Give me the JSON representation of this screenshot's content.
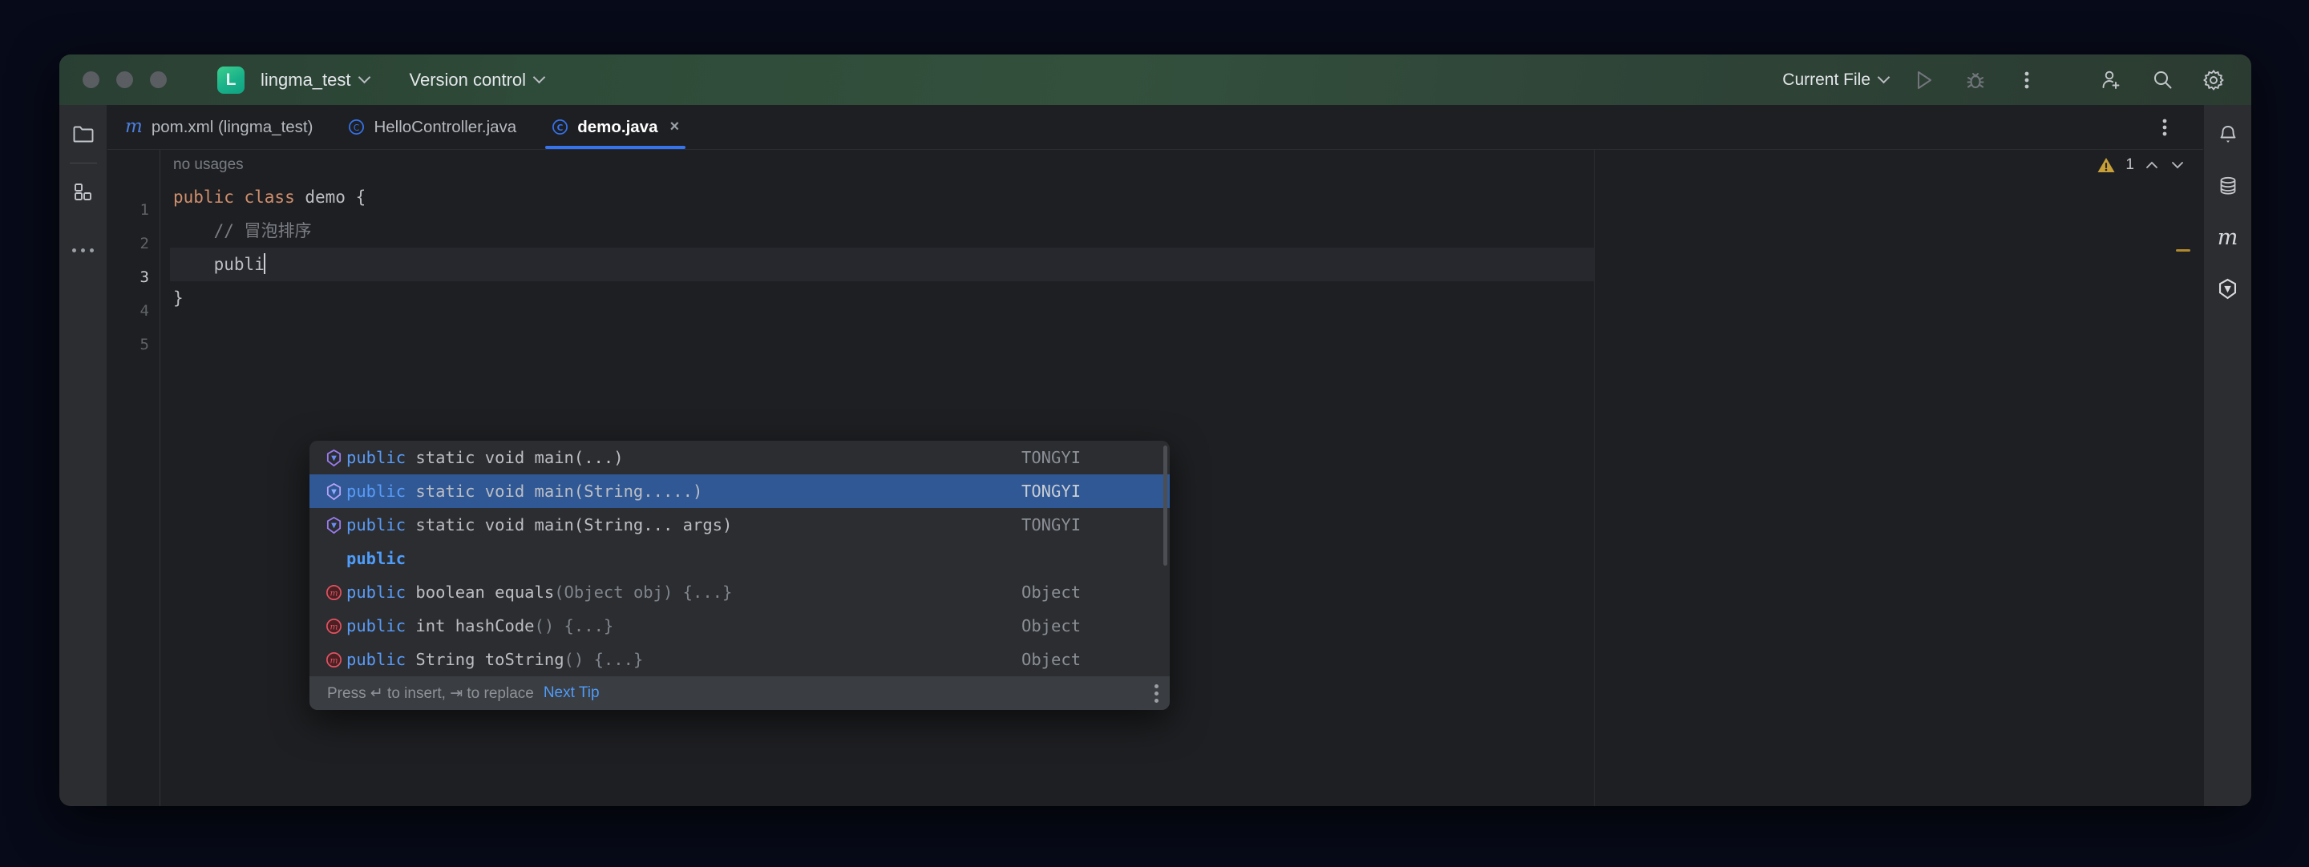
{
  "window": {
    "title_bar": {
      "project_name": "lingma_test",
      "project_logo_letter": "L",
      "version_control_label": "Version control",
      "run_config_label": "Current File"
    }
  },
  "left_rail": {
    "items": [
      {
        "name": "project-tool-window",
        "icon": "folder-icon"
      },
      {
        "name": "structure-tool-window",
        "icon": "structure-icon"
      },
      {
        "name": "more-tool-windows",
        "icon": "more-horizontal-icon"
      }
    ]
  },
  "right_rail": {
    "items": [
      {
        "name": "notifications",
        "icon": "bell-icon"
      },
      {
        "name": "database",
        "icon": "database-icon"
      },
      {
        "name": "maven",
        "icon": "maven-m-icon"
      },
      {
        "name": "lingma-assistant",
        "icon": "lingma-icon"
      }
    ]
  },
  "editor_tabs": [
    {
      "label": "pom.xml (lingma_test)",
      "icon": "maven-file-icon",
      "active": false,
      "closable": false
    },
    {
      "label": "HelloController.java",
      "icon": "java-class-icon",
      "active": false,
      "closable": false
    },
    {
      "label": "demo.java",
      "icon": "java-class-icon",
      "active": true,
      "closable": true,
      "close_glyph": "×"
    }
  ],
  "editor": {
    "inlay_hint": "no usages",
    "gutter_lines": [
      "1",
      "2",
      "3",
      "4",
      "5"
    ],
    "current_line": "3",
    "code_lines": [
      {
        "n": "1",
        "segments": [
          {
            "t": "public class ",
            "c": "kw"
          },
          {
            "t": "demo {",
            "c": "plain"
          }
        ]
      },
      {
        "n": "2",
        "segments": [
          {
            "t": "    // 冒泡排序",
            "c": "cmt"
          }
        ]
      },
      {
        "n": "3",
        "segments": [
          {
            "t": "    publi",
            "c": "plain"
          }
        ],
        "caret": true
      },
      {
        "n": "4",
        "segments": [
          {
            "t": "}",
            "c": "plain"
          }
        ]
      },
      {
        "n": "5",
        "segments": [
          {
            "t": "",
            "c": "plain"
          }
        ]
      }
    ],
    "inspection_widget": {
      "warning_count": "1",
      "warning_icon": "warning-triangle-icon",
      "prev_icon": "chevron-up-icon",
      "next_icon": "chevron-down-icon"
    }
  },
  "completion_popup": {
    "items": [
      {
        "icon": "tongyi-icon",
        "prefix": "public",
        "rest": " static void main(...)",
        "dim": "",
        "source": "TONGYI",
        "selected": false
      },
      {
        "icon": "tongyi-icon",
        "prefix": "public",
        "rest": " static void main(String.....)",
        "dim": "",
        "source": "TONGYI",
        "selected": true
      },
      {
        "icon": "tongyi-icon",
        "prefix": "public",
        "rest": " static void main(String... args)",
        "dim": "",
        "source": "TONGYI",
        "selected": false
      },
      {
        "icon": "",
        "prefix": "public",
        "rest": "",
        "dim": "",
        "source": "",
        "selected": false,
        "bold": true
      },
      {
        "icon": "method-icon",
        "prefix": "public",
        "rest": " boolean equals",
        "dim": "(Object obj) {...}",
        "source": "Object",
        "selected": false
      },
      {
        "icon": "method-icon",
        "prefix": "public",
        "rest": " int hashCode",
        "dim": "() {...}",
        "source": "Object",
        "selected": false
      },
      {
        "icon": "method-icon",
        "prefix": "public",
        "rest": " String toString",
        "dim": "() {...}",
        "source": "Object",
        "selected": false
      }
    ],
    "footer": {
      "hint": "Press ↵ to insert, ⇥ to replace",
      "next_tip": "Next Tip",
      "menu_icon": "more-vertical-icon"
    }
  },
  "colors": {
    "accent_blue": "#3574f0",
    "selection_blue": "#2f5895",
    "titlebar_green": "#33503d",
    "keyword_orange": "#cf8e6d",
    "warning_amber": "#c8a03a",
    "editor_bg": "#1e1f22",
    "panel_bg": "#2b2d30"
  }
}
